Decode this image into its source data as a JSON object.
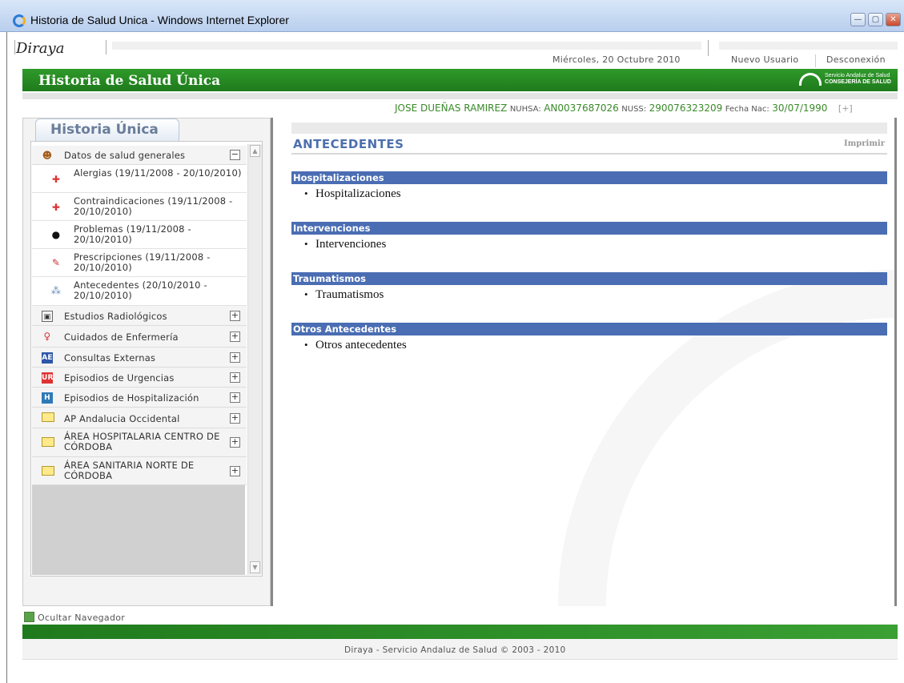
{
  "window": {
    "title": "Historia de Salud Unica - Windows Internet Explorer",
    "buttons": [
      "—",
      "▢",
      "✕"
    ]
  },
  "header": {
    "logo": "Diraya",
    "date": "Miércoles, 20 Octubre 2010",
    "new_user": "Nuevo Usuario",
    "logout": "Desconexión",
    "app_title": "Historia de Salud Única",
    "org_line1": "Servicio Andaluz de Salud",
    "org_line2": "CONSEJERÍA DE SALUD"
  },
  "patient": {
    "name": "JOSE DUEÑAS RAMIREZ",
    "nuhsa_label": "NUHSA:",
    "nuhsa": "AN0037687026",
    "nuss_label": "NUSS:",
    "nuss": "290076323209",
    "dob_label": "Fecha Nac:",
    "dob": "30/07/1990",
    "expand": "[+]"
  },
  "sidebar": {
    "tab": "Historia Única",
    "group_label": "Datos de salud generales",
    "group_toggle": "−",
    "sub_items": [
      {
        "label": "Alergias (19/11/2008 - 20/10/2010)",
        "icon": "allergy-icon"
      },
      {
        "label": "Contraindicaciones (19/11/2008 - 20/10/2010)",
        "icon": "contraindication-icon"
      },
      {
        "label": "Problemas (19/11/2008 - 20/10/2010)",
        "icon": "problem-icon"
      },
      {
        "label": "Prescripciones (19/11/2008 - 20/10/2010)",
        "icon": "prescription-icon"
      },
      {
        "label": "Antecedentes (20/10/2010 - 20/10/2010)",
        "icon": "history-icon"
      }
    ],
    "items": [
      {
        "label": "Estudios Radiológicos",
        "icon": "radiology-icon",
        "icon_text": "▣"
      },
      {
        "label": "Cuidados de Enfermería",
        "icon": "nurse-icon",
        "icon_text": "♀"
      },
      {
        "label": "Consultas Externas",
        "icon": "ae-icon",
        "icon_text": "AE"
      },
      {
        "label": "Episodios de Urgencias",
        "icon": "ur-icon",
        "icon_text": "UR"
      },
      {
        "label": "Episodios de Hospitalización",
        "icon": "h-icon",
        "icon_text": "H"
      },
      {
        "label": "AP Andalucia Occidental",
        "icon": "folder-icon",
        "icon_text": ""
      },
      {
        "label": "ÁREA HOSPITALARIA CENTRO DE CÓRDOBA",
        "icon": "folder-icon",
        "icon_text": ""
      },
      {
        "label": "ÁREA SANITARIA NORTE DE CÓRDOBA",
        "icon": "folder-icon",
        "icon_text": ""
      }
    ],
    "expand_symbol": "+",
    "hide_nav": "Ocultar Navegador"
  },
  "content": {
    "title": "ANTECEDENTES",
    "print": "Imprimir",
    "sections": [
      {
        "heading": "Hospitalizaciones",
        "item": "Hospitalizaciones"
      },
      {
        "heading": "Intervenciones",
        "item": "Intervenciones"
      },
      {
        "heading": "Traumatismos",
        "item": "Traumatismos"
      },
      {
        "heading": "Otros Antecedentes",
        "item": "Otros antecedentes"
      }
    ]
  },
  "footer": {
    "text": "Diraya - Servicio Andaluz de Salud © 2003 - 2010"
  }
}
